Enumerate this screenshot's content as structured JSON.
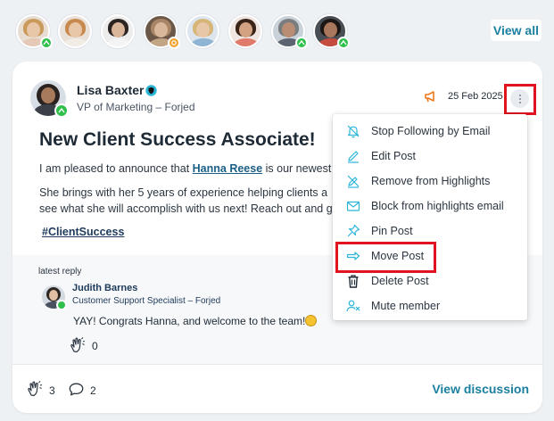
{
  "colors": {
    "accent": "#1b7fa0",
    "highlight_box": "#e0141e",
    "badge_green": "#2ec04a",
    "badge_gold": "#f2a22a",
    "icon_teal": "#2bb5d8"
  },
  "top_members": {
    "view_all_label": "View all",
    "avatars": [
      {
        "name": "member-1",
        "badge": "green"
      },
      {
        "name": "member-2",
        "badge": null
      },
      {
        "name": "member-3",
        "badge": null
      },
      {
        "name": "member-4",
        "badge": "gold"
      },
      {
        "name": "member-5",
        "badge": null
      },
      {
        "name": "member-6",
        "badge": null
      },
      {
        "name": "member-7",
        "badge": "green"
      },
      {
        "name": "member-8",
        "badge": "green"
      }
    ]
  },
  "post": {
    "author_name": "Lisa Baxter",
    "author_role": "VP of Marketing – Forjed",
    "date": "25 Feb 2025",
    "title": "New Client Success Associate!",
    "body_intro": "I am pleased to announce that ",
    "mention": "Hanna Reese",
    "body_intro_tail": " is our newest",
    "body_para2_line1": "She brings with her 5 years of experience helping clients a",
    "body_para2_line2": "see what she will accomplish with us next! Reach out and g",
    "hashtag": "#ClientSuccess"
  },
  "latest_reply": {
    "label": "latest reply",
    "name": "Judith Barnes",
    "role": "Customer Support Specialist – Forjed",
    "text": "YAY! Congrats Hanna, and welcome to the team!",
    "clap_count": "0"
  },
  "footer": {
    "clap_count": "3",
    "comment_count": "2",
    "view_discussion_label": "View discussion"
  },
  "menu": {
    "items": [
      {
        "label": "Stop Following by Email",
        "icon": "bell-off-icon"
      },
      {
        "label": "Edit Post",
        "icon": "pencil-icon"
      },
      {
        "label": "Remove from Highlights",
        "icon": "highlight-off-icon"
      },
      {
        "label": "Block from highlights email",
        "icon": "mail-icon"
      },
      {
        "label": "Pin Post",
        "icon": "pin-icon"
      },
      {
        "label": "Move Post",
        "icon": "arrow-right-icon"
      },
      {
        "label": "Delete Post",
        "icon": "trash-icon"
      },
      {
        "label": "Mute member",
        "icon": "mute-user-icon"
      }
    ]
  }
}
